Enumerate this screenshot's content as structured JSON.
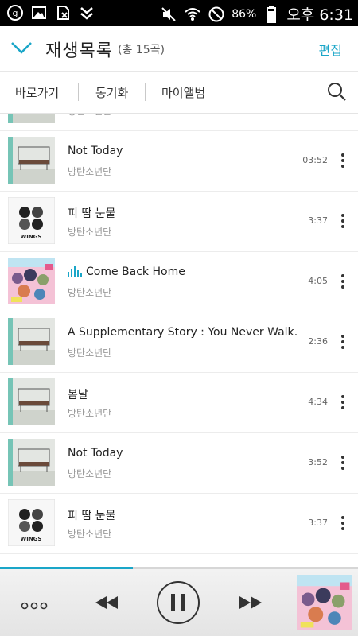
{
  "status_bar": {
    "battery": "86%",
    "time": "오후 6:31"
  },
  "header": {
    "title": "재생목록",
    "count": "(총 15곡)",
    "edit": "편집"
  },
  "tabs": [
    "바로가기",
    "동기화",
    "마이앨범"
  ],
  "songs": [
    {
      "title": "Not Today",
      "artist": "방탄소년단",
      "duration": "03:52",
      "art": "bus"
    },
    {
      "title": "피 땀 눈물",
      "artist": "방탄소년단",
      "duration": "3:37",
      "art": "wings"
    },
    {
      "title": "Come Back Home",
      "artist": "방탄소년단",
      "duration": "4:05",
      "art": "colorful",
      "playing": true
    },
    {
      "title": "A Supplementary Story : You Never Walk…",
      "artist": "방탄소년단",
      "duration": "2:36",
      "art": "bus"
    },
    {
      "title": "봄날",
      "artist": "방탄소년단",
      "duration": "4:34",
      "art": "bus"
    },
    {
      "title": "Not Today",
      "artist": "방탄소년단",
      "duration": "3:52",
      "art": "bus"
    },
    {
      "title": "피 땀 눈물",
      "artist": "방탄소년단",
      "duration": "3:37",
      "art": "wings"
    }
  ],
  "wings_label": "WINGS",
  "progress": 0.37,
  "colors": {
    "accent": "#1aa6c8"
  },
  "icons": [
    "g-app-icon",
    "image-icon",
    "sim-off-icon",
    "check-app-icon",
    "mute-icon",
    "wifi-icon",
    "do-not-disturb-icon",
    "battery-icon",
    "chevron-down-icon",
    "search-icon",
    "more-vert-icon",
    "equalizer-icon",
    "more-horiz-icon",
    "previous-icon",
    "pause-icon",
    "next-icon"
  ]
}
